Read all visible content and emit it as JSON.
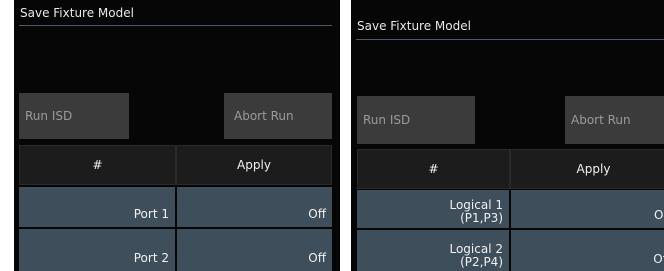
{
  "left": {
    "title": "Save Fixture Model",
    "run_label": "Run ISD",
    "abort_label": "Abort Run",
    "columns": [
      "#",
      "Apply"
    ],
    "rows": [
      {
        "name": "Port 1",
        "apply": "Off"
      },
      {
        "name": "Port 2",
        "apply": "Off"
      }
    ]
  },
  "right": {
    "title": "Save Fixture Model",
    "run_label": "Run ISD",
    "abort_label": "Abort Run",
    "columns": [
      "#",
      "Apply"
    ],
    "rows": [
      {
        "name_line1": "Logical 1",
        "name_line2": "(P1,P3)",
        "apply": "On"
      },
      {
        "name_line1": "Logical 2",
        "name_line2": "(P2,P4)",
        "apply": "Off"
      }
    ]
  },
  "colors": {
    "panel_bg": "#060606",
    "button_bg": "#3b3b3b",
    "header_bg": "#1c1c1c",
    "row_bg": "#3e4e5b",
    "title_line": "#4a5a68"
  }
}
